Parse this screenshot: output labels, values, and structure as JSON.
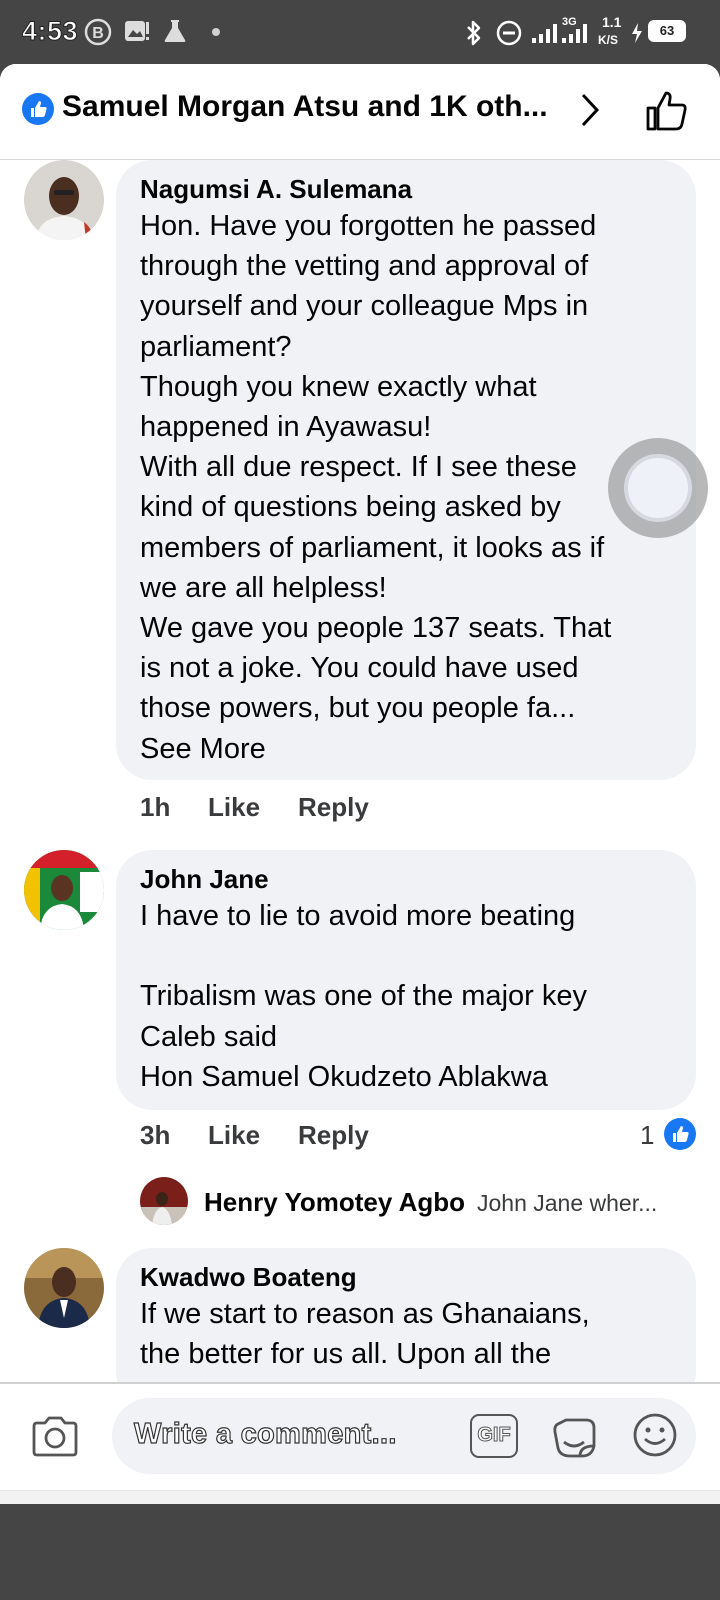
{
  "status_bar": {
    "time": "4:53",
    "network_label": "3G",
    "speed_value": "1.1",
    "speed_unit": "K/S",
    "battery": "63"
  },
  "header": {
    "title": "Samuel Morgan Atsu and 1K oth...",
    "accent_color": "#1877f2"
  },
  "comments": [
    {
      "author": "Nagumsi A. Sulemana",
      "text": "Hon. Have you forgotten he passed\nthrough the vetting and approval of\nyourself and your colleague Mps in\nparliament?\nThough you knew exactly what\nhappened in Ayawasu!\nWith all due respect. If I see these\nkind of questions being asked by\nmembers of parliament, it looks as if\nwe are all helpless!\nWe gave you people 137 seats. That\nis not a joke. You could have used\nthose powers, but you people fa...",
      "see_more": "See More",
      "time": "1h",
      "like": "Like",
      "reply": "Reply"
    },
    {
      "author": "John Jane",
      "text": "I have to lie to avoid more beating\n\nTribalism was one of the major key\nCaleb said\nHon Samuel Okudzeto Ablakwa",
      "time": "3h",
      "like": "Like",
      "reply": "Reply",
      "reaction_count": "1",
      "reply_preview": {
        "author": "Henry Yomotey Agbo",
        "text": "John Jane wher..."
      }
    },
    {
      "author": "Kwadwo Boateng",
      "text": "If we start to reason as Ghanaians,\nthe better for us all. Upon all the"
    }
  ],
  "composer": {
    "placeholder": "Write a comment...",
    "gif_label": "GIF",
    "icons": [
      "camera-icon",
      "gif-icon",
      "sticker-icon",
      "emoji-icon"
    ]
  },
  "nav": {
    "icons": [
      "recents-icon",
      "home-icon",
      "back-icon",
      "accessibility-icon"
    ]
  }
}
